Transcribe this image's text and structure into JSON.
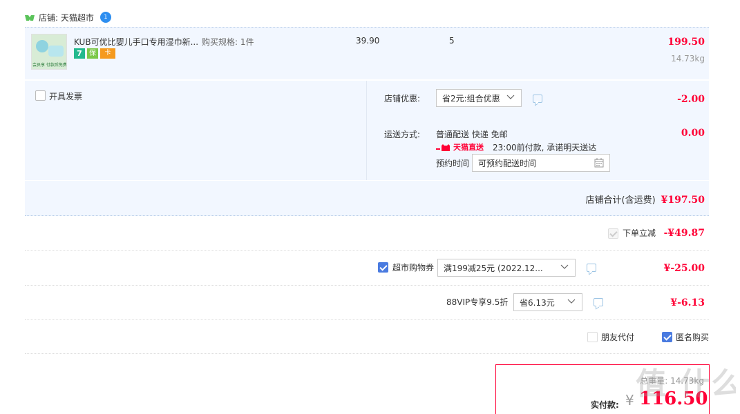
{
  "shop": {
    "label": "店铺: 天猫超市",
    "badge": "1"
  },
  "item": {
    "title": "KUB可优比婴儿手口专用湿巾新...",
    "spec": "购买规格: 1件",
    "price": "39.90",
    "qty": "5",
    "subtotal": "199.50",
    "weight": "14.73kg",
    "thumb_text": "会员享  付款后免费",
    "badges": [
      "7",
      "保",
      "卡"
    ]
  },
  "invoice": {
    "label": "开具发票"
  },
  "discount": {
    "label": "店铺优惠:",
    "selected": "省2元:组合优惠",
    "amount": "-2.00"
  },
  "shipping": {
    "label": "运送方式:",
    "method": "普通配送 快递 免邮",
    "amount": "0.00",
    "brand": "天猫直送",
    "promise": "23:00前付款, 承诺明天送达",
    "reserve_label": "预约时间",
    "reserve_placeholder": "可预约配送时间"
  },
  "shop_total": {
    "label": "店铺合计(含运费)",
    "amount": "¥197.50"
  },
  "instant": {
    "label": "下单立减",
    "amount": "-¥49.87"
  },
  "coupon": {
    "label": "超市购物券",
    "selected": "满199减25元 (2022.12...",
    "amount": "¥-25.00"
  },
  "vip": {
    "label": "88VIP专享9.5折",
    "selected": "省6.13元",
    "amount": "¥-6.13"
  },
  "options": {
    "friend_pay": "朋友代付",
    "anonymous": "匿名购买"
  },
  "summary": {
    "weight_label": "总重量: 14.73kg",
    "pay_label": "实付款:",
    "currency": "¥",
    "pay_amount": "116.50"
  },
  "watermark": "值 什么值得买",
  "colors": {
    "accent_red": "#ff0036",
    "panel_blue": "#f2f7ff",
    "check_blue": "#4a7be0"
  }
}
